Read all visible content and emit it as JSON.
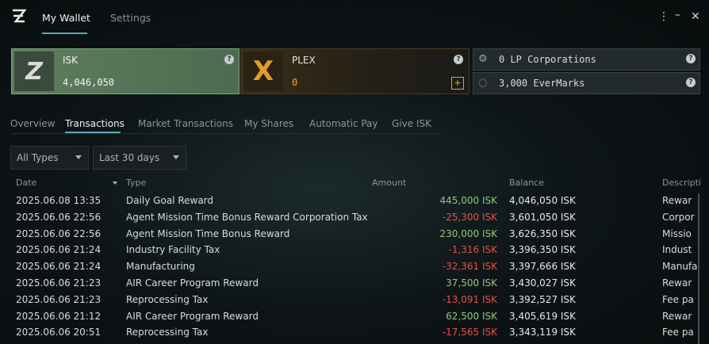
{
  "window": {
    "tabs": [
      {
        "label": "My Wallet",
        "active": true
      },
      {
        "label": "Settings",
        "active": false
      }
    ],
    "menu_icon": "more-vertical-icon",
    "minimize_icon": "minimize-icon",
    "close_icon": "close-icon",
    "accent_color": "#58a7b8"
  },
  "currencies": {
    "isk": {
      "label": "ISK",
      "value": "4,046,050",
      "help": "?"
    },
    "plex": {
      "label": "PLEX",
      "value": "0",
      "help": "?",
      "add_label": "+"
    },
    "lp": {
      "label": "0 LP Corporations",
      "help": "?"
    },
    "evermarks": {
      "label": "3,000 EverMarks",
      "help": "?"
    }
  },
  "subtabs": [
    {
      "label": "Overview",
      "active": false
    },
    {
      "label": "Transactions",
      "active": true
    },
    {
      "label": "Market Transactions",
      "active": false
    },
    {
      "label": "My Shares",
      "active": false
    },
    {
      "label": "Automatic Pay",
      "active": false
    },
    {
      "label": "Give ISK",
      "active": false
    }
  ],
  "filters": {
    "type": "All Types",
    "period": "Last 30 days"
  },
  "table": {
    "columns": [
      "Date",
      "Type",
      "Amount",
      "Balance",
      "Descripti"
    ],
    "rows": [
      {
        "date": "2025.06.08 13:35",
        "type": "Daily Goal Reward",
        "amount": "445,000 ISK",
        "balance": "4,046,050 ISK",
        "desc": "Rewar",
        "sign": "pos"
      },
      {
        "date": "2025.06.06 22:56",
        "type": "Agent Mission Time Bonus Reward Corporation Tax",
        "amount": "-25,300 ISK",
        "balance": "3,601,050 ISK",
        "desc": "Corpor",
        "sign": "neg"
      },
      {
        "date": "2025.06.06 22:56",
        "type": "Agent Mission Time Bonus Reward",
        "amount": "230,000 ISK",
        "balance": "3,626,350 ISK",
        "desc": "Missio",
        "sign": "pos"
      },
      {
        "date": "2025.06.06 21:24",
        "type": "Industry Facility Tax",
        "amount": "-1,316 ISK",
        "balance": "3,396,350 ISK",
        "desc": "Indust",
        "sign": "neg"
      },
      {
        "date": "2025.06.06 21:24",
        "type": "Manufacturing",
        "amount": "-32,361 ISK",
        "balance": "3,397,666 ISK",
        "desc": "Manufa",
        "sign": "neg"
      },
      {
        "date": "2025.06.06 21:23",
        "type": "AIR Career Program Reward",
        "amount": "37,500 ISK",
        "balance": "3,430,027 ISK",
        "desc": "Rewar",
        "sign": "pos"
      },
      {
        "date": "2025.06.06 21:23",
        "type": "Reprocessing Tax",
        "amount": "-13,091 ISK",
        "balance": "3,392,527 ISK",
        "desc": "Fee pa",
        "sign": "neg"
      },
      {
        "date": "2025.06.06 21:12",
        "type": "AIR Career Program Reward",
        "amount": "62,500 ISK",
        "balance": "3,405,619 ISK",
        "desc": "Rewar",
        "sign": "pos"
      },
      {
        "date": "2025.06.06 20:51",
        "type": "Reprocessing Tax",
        "amount": "-17,565 ISK",
        "balance": "3,343,119 ISK",
        "desc": "Fee pa",
        "sign": "neg"
      }
    ]
  }
}
